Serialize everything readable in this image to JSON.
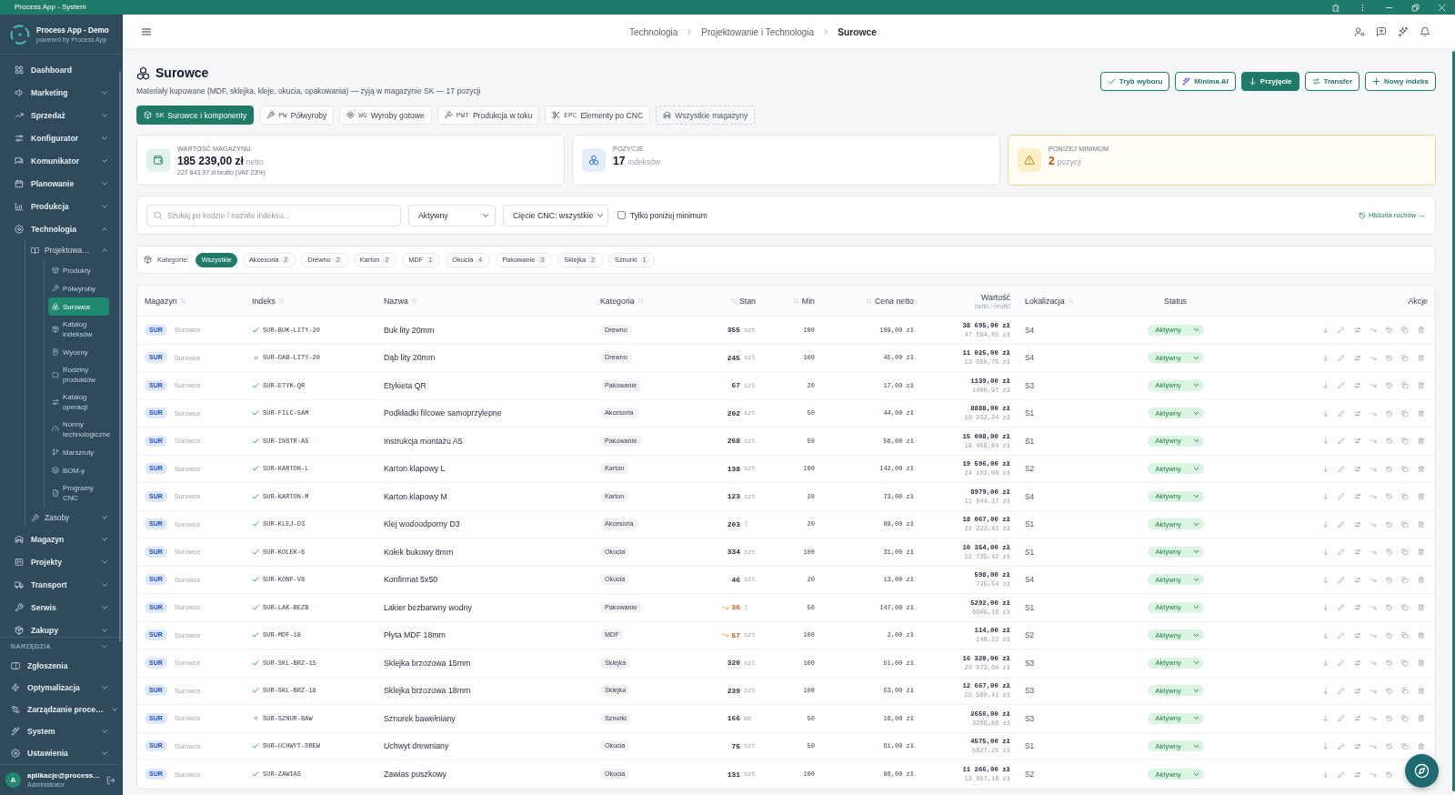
{
  "window": {
    "title": "Process App - System"
  },
  "sidebar": {
    "app_name": "Process App - Demo",
    "app_tagline": "powered by Process App",
    "items": [
      {
        "label": "Dashboard",
        "selected": false
      },
      {
        "label": "Marketing",
        "expanded": false,
        "selected": false
      },
      {
        "label": "Sprzedaż",
        "expanded": false,
        "selected": false
      },
      {
        "label": "Konfigurator",
        "expanded": false,
        "selected": false
      },
      {
        "label": "Komunikator",
        "expanded": false,
        "selected": false
      },
      {
        "label": "Planowanie",
        "expanded": false,
        "selected": false
      },
      {
        "label": "Produkcja",
        "expanded": false,
        "selected": false
      },
      {
        "label": "Technologia",
        "expanded": true,
        "selected": false,
        "children": [
          {
            "label": "Projektowa…",
            "expanded": true,
            "selected": false,
            "children": [
              {
                "label": "Produkty",
                "selected": false
              },
              {
                "label": "Półwyroby",
                "selected": false
              },
              {
                "label": "Surowce",
                "selected": true
              },
              {
                "label": "Katalog indeksów",
                "selected": false
              },
              {
                "label": "Wyceny",
                "selected": false
              },
              {
                "label": "Rodziny produktów",
                "selected": false
              },
              {
                "label": "Katalog operacji",
                "selected": false
              },
              {
                "label": "Normy technologiczne",
                "selected": false
              },
              {
                "label": "Marszruty",
                "selected": false
              },
              {
                "label": "BOM-y",
                "selected": false
              },
              {
                "label": "Programy CNC",
                "selected": false
              }
            ]
          },
          {
            "label": "Zasoby",
            "expanded": false,
            "selected": false
          }
        ]
      },
      {
        "label": "Magazyn",
        "expanded": false,
        "selected": false
      },
      {
        "label": "Projekty",
        "expanded": false,
        "selected": false
      },
      {
        "label": "Transport",
        "expanded": false,
        "selected": false
      },
      {
        "label": "Serwis",
        "expanded": false,
        "selected": false
      },
      {
        "label": "Zakupy",
        "expanded": false,
        "selected": false
      }
    ],
    "tools_section": {
      "title": "NARZĘDZIA",
      "expanded": true,
      "items": [
        {
          "label": "Zgłoszenia",
          "selected": false
        },
        {
          "label": "Optymalizacja",
          "expanded": false,
          "selected": false
        },
        {
          "label": "Zarządzanie proce…",
          "expanded": false,
          "selected": false
        },
        {
          "label": "System",
          "expanded": false,
          "selected": false
        },
        {
          "label": "Ustawienia",
          "expanded": false,
          "selected": false
        }
      ]
    },
    "user": {
      "initial": "A",
      "name": "aplikacje@process…",
      "role": "Administrator"
    }
  },
  "breadcrumb": [
    {
      "label": "Technologia",
      "current": false
    },
    {
      "label": "Projektowanie i Technologia",
      "current": false
    },
    {
      "label": "Surowce",
      "current": true
    }
  ],
  "page": {
    "title": "Surowce",
    "subtitle": "Materiały kupowane (MDF, sklejka, kleje, okucia, opakowania) — żyją w magazynie SK — 17 pozycji",
    "actions": [
      {
        "label": "Tryb wyboru",
        "kind": "outline"
      },
      {
        "label": "Minima AI",
        "kind": "outline"
      },
      {
        "label": "Przyjęcie",
        "kind": "primary"
      },
      {
        "label": "Transfer",
        "kind": "outline"
      },
      {
        "label": "Nowy indeks",
        "kind": "outline"
      }
    ]
  },
  "warehouse_tabs": [
    {
      "code": "SK",
      "label": "Surowce i komponenty",
      "kind": "warehouse",
      "selected": true
    },
    {
      "code": "PW",
      "label": "Półwyroby",
      "kind": "warehouse",
      "selected": false
    },
    {
      "code": "WG",
      "label": "Wyroby gotowe",
      "kind": "warehouse",
      "selected": false
    },
    {
      "code": "PWT",
      "label": "Produkcja w toku",
      "kind": "warehouse",
      "selected": false
    },
    {
      "code": "EPC",
      "label": "Elementy po CNC",
      "kind": "warehouse",
      "selected": false
    },
    {
      "label": "Wszystkie magazyny",
      "kind": "all",
      "selected": false
    }
  ],
  "stats": [
    {
      "kind": "value",
      "label": "WARTOŚĆ MAGAZYNU",
      "value": "185 239,00 zł",
      "unit": "netto",
      "note": "227 843,97 zł brutto (VAT 23%)"
    },
    {
      "kind": "count",
      "label": "POZYCJE",
      "value": "17",
      "unit": "indeksów"
    },
    {
      "kind": "warning",
      "label": "PONIŻEJ MINIMUM",
      "value": "2",
      "unit": "pozycji"
    }
  ],
  "filters": {
    "search": {
      "placeholder": "Szukaj po kodzie / nazwie indeksu..."
    },
    "status_select": {
      "value": "Aktywny"
    },
    "cnc_select": {
      "value": "Cięcie CNC: wszystkie"
    },
    "below_min_only": {
      "label": "Tylko poniżej minimum",
      "checked": false
    },
    "history_link": "Historia ruchów →"
  },
  "categories": {
    "label": "Kategorie:",
    "chips": [
      {
        "label": "Wszystkie",
        "selected": true
      },
      {
        "label": "Akcesoria",
        "count": "2",
        "selected": false
      },
      {
        "label": "Drewno",
        "count": "2",
        "selected": false
      },
      {
        "label": "Karton",
        "count": "2",
        "selected": false
      },
      {
        "label": "MDF",
        "count": "1",
        "selected": false
      },
      {
        "label": "Okucia",
        "count": "4",
        "selected": false
      },
      {
        "label": "Pakowanie",
        "count": "3",
        "selected": false
      },
      {
        "label": "Sklejka",
        "count": "2",
        "selected": false
      },
      {
        "label": "Sznurki",
        "count": "1",
        "selected": false
      }
    ]
  },
  "table": {
    "columns": [
      {
        "label": "Magazyn",
        "sortable": true
      },
      {
        "label": "Indeks",
        "sortable": true
      },
      {
        "label": "Nazwa",
        "sortable": true
      },
      {
        "label": "Kategoria",
        "sortable": true
      },
      {
        "label": "Stan",
        "sortable": true
      },
      {
        "label": "Min",
        "sortable": true
      },
      {
        "label": "Cena netto",
        "sortable": true
      },
      {
        "label": "Wartość",
        "sublabel": "netto / brutto",
        "sortable": false
      },
      {
        "label": "Lokalizacja",
        "sortable": true
      },
      {
        "label": "Status",
        "sortable": false
      },
      {
        "label": "Akcje",
        "sortable": false
      }
    ],
    "rows": [
      {
        "warehouse_code": "SUR",
        "warehouse": "Surowce",
        "verified": true,
        "index": "SUR-BUK-LITY-20",
        "name": "Buk lity 20mm",
        "category": "Drewno",
        "stock": "355",
        "unit": "szt",
        "below_min": false,
        "min": "100",
        "price": "109,00 zł",
        "value": "38 695,00 zł",
        "value_gross": "47 594,85 zł",
        "location": "S4",
        "status": "Aktywny"
      },
      {
        "warehouse_code": "SUR",
        "warehouse": "Surowce",
        "verified": false,
        "index": "SUR-DAB-LITY-20",
        "name": "Dąb lity 20mm",
        "category": "Drewno",
        "stock": "245",
        "unit": "szt",
        "below_min": false,
        "min": "100",
        "price": "45,00 zł",
        "value": "11 025,00 zł",
        "value_gross": "13 560,75 zł",
        "location": "S4",
        "status": "Aktywny"
      },
      {
        "warehouse_code": "SUR",
        "warehouse": "Surowce",
        "verified": true,
        "index": "SUR-ETYK-QR",
        "name": "Etykieta QR",
        "category": "Pakowanie",
        "stock": "67",
        "unit": "szt",
        "below_min": false,
        "min": "20",
        "price": "17,00 zł",
        "value": "1139,00 zł",
        "value_gross": "1400,97 zł",
        "location": "S3",
        "status": "Aktywny"
      },
      {
        "warehouse_code": "SUR",
        "warehouse": "Surowce",
        "verified": true,
        "index": "SUR-FILC-SAM",
        "name": "Podkładki filcowe samoprzylepne",
        "category": "Akcesoria",
        "stock": "202",
        "unit": "szt",
        "below_min": false,
        "min": "50",
        "price": "44,00 zł",
        "value": "8888,00 zł",
        "value_gross": "10 932,24 zł",
        "location": "S1",
        "status": "Aktywny"
      },
      {
        "warehouse_code": "SUR",
        "warehouse": "Surowce",
        "verified": true,
        "index": "SUR-INSTR-A5",
        "name": "Instrukcja montażu A5",
        "category": "Pakowanie",
        "stock": "268",
        "unit": "szt",
        "below_min": false,
        "min": "50",
        "price": "56,00 zł",
        "value": "15 008,00 zł",
        "value_gross": "18 459,84 zł",
        "location": "S1",
        "status": "Aktywny"
      },
      {
        "warehouse_code": "SUR",
        "warehouse": "Surowce",
        "verified": true,
        "index": "SUR-KARTON-L",
        "name": "Karton klapowy L",
        "category": "Karton",
        "stock": "138",
        "unit": "szt",
        "below_min": false,
        "min": "100",
        "price": "142,00 zł",
        "value": "19 596,00 zł",
        "value_gross": "24 103,08 zł",
        "location": "S2",
        "status": "Aktywny"
      },
      {
        "warehouse_code": "SUR",
        "warehouse": "Surowce",
        "verified": true,
        "index": "SUR-KARTON-M",
        "name": "Karton klapowy M",
        "category": "Karton",
        "stock": "123",
        "unit": "szt",
        "below_min": false,
        "min": "20",
        "price": "73,00 zł",
        "value": "8979,00 zł",
        "value_gross": "11 044,17 zł",
        "location": "S4",
        "status": "Aktywny"
      },
      {
        "warehouse_code": "SUR",
        "warehouse": "Surowce",
        "verified": true,
        "index": "SUR-KLEJ-D3",
        "name": "Klej wodoodporny D3",
        "category": "Akcesoria",
        "stock": "203",
        "unit": "l",
        "below_min": false,
        "min": "20",
        "price": "89,00 zł",
        "value": "18 067,00 zł",
        "value_gross": "22 222,41 zł",
        "location": "S1",
        "status": "Aktywny"
      },
      {
        "warehouse_code": "SUR",
        "warehouse": "Surowce",
        "verified": true,
        "index": "SUR-KOLEK-8",
        "name": "Kołek bukowy 8mm",
        "category": "Okucia",
        "stock": "334",
        "unit": "szt",
        "below_min": false,
        "min": "100",
        "price": "31,00 zł",
        "value": "10 354,00 zł",
        "value_gross": "12 735,42 zł",
        "location": "S1",
        "status": "Aktywny"
      },
      {
        "warehouse_code": "SUR",
        "warehouse": "Surowce",
        "verified": true,
        "index": "SUR-KONF-V8",
        "name": "Konfirmat 5x50",
        "category": "Okucia",
        "stock": "46",
        "unit": "szt",
        "below_min": false,
        "min": "20",
        "price": "13,00 zł",
        "value": "598,00 zł",
        "value_gross": "735,54 zł",
        "location": "S4",
        "status": "Aktywny"
      },
      {
        "warehouse_code": "SUR",
        "warehouse": "Surowce",
        "verified": true,
        "index": "SUR-LAK-BEZB",
        "name": "Lakier bezbarwny wodny",
        "category": "Pakowanie",
        "stock": "36",
        "unit": "l",
        "below_min": true,
        "min": "50",
        "price": "147,00 zł",
        "value": "5292,00 zł",
        "value_gross": "6509,16 zł",
        "location": "S1",
        "status": "Aktywny"
      },
      {
        "warehouse_code": "SUR",
        "warehouse": "Surowce",
        "verified": true,
        "index": "SUR-MDF-18",
        "name": "Płyta MDF 18mm",
        "category": "MDF",
        "stock": "57",
        "unit": "szt",
        "below_min": true,
        "min": "100",
        "price": "2,00 zł",
        "value": "114,00 zł",
        "value_gross": "140,22 zł",
        "location": "S2",
        "status": "Aktywny"
      },
      {
        "warehouse_code": "SUR",
        "warehouse": "Surowce",
        "verified": true,
        "index": "SUR-SKL-BRZ-15",
        "name": "Sklejka brzozowa 15mm",
        "category": "Sklejka",
        "stock": "320",
        "unit": "szt",
        "below_min": false,
        "min": "100",
        "price": "51,00 zł",
        "value": "16 320,00 zł",
        "value_gross": "20 073,60 zł",
        "location": "S3",
        "status": "Aktywny"
      },
      {
        "warehouse_code": "SUR",
        "warehouse": "Surowce",
        "verified": true,
        "index": "SUR-SKL-BRZ-18",
        "name": "Sklejka brzozowa 18mm",
        "category": "Sklejka",
        "stock": "239",
        "unit": "szt",
        "below_min": false,
        "min": "100",
        "price": "53,00 zł",
        "value": "12 667,00 zł",
        "value_gross": "15 580,41 zł",
        "location": "S3",
        "status": "Aktywny"
      },
      {
        "warehouse_code": "SUR",
        "warehouse": "Surowce",
        "verified": false,
        "index": "SUR-SZNUR-BAW",
        "name": "Sznurek bawełniany",
        "category": "Sznurki",
        "stock": "166",
        "unit": "mb",
        "below_min": false,
        "min": "50",
        "price": "16,00 zł",
        "value": "2656,00 zł",
        "value_gross": "3266,88 zł",
        "location": "S3",
        "status": "Aktywny"
      },
      {
        "warehouse_code": "SUR",
        "warehouse": "Surowce",
        "verified": true,
        "index": "SUR-UCHWYT-DREW",
        "name": "Uchwyt drewniany",
        "category": "Okucia",
        "stock": "75",
        "unit": "szt",
        "below_min": false,
        "min": "50",
        "price": "61,00 zł",
        "value": "4575,00 zł",
        "value_gross": "5627,25 zł",
        "location": "S1",
        "status": "Aktywny"
      },
      {
        "warehouse_code": "SUR",
        "warehouse": "Surowce",
        "verified": true,
        "index": "SUR-ZAWIAS",
        "name": "Zawias puszkowy",
        "category": "Okucia",
        "stock": "131",
        "unit": "szt",
        "below_min": false,
        "min": "100",
        "price": "86,00 zł",
        "value": "11 266,00 zł",
        "value_gross": "13 857,18 zł",
        "location": "S2",
        "status": "Aktywny"
      }
    ]
  }
}
